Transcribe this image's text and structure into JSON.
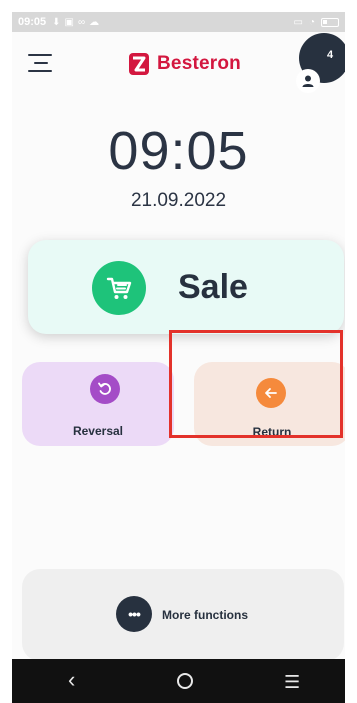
{
  "status_bar": {
    "time": "09:05",
    "icons": [
      "download-icon",
      "image-icon",
      "link-icon",
      "cloud-icon"
    ],
    "right_icons": [
      "cast-icon",
      "wifi-icon",
      "battery-icon"
    ]
  },
  "header": {
    "brand": "Besteron",
    "brand_color": "#d3173f",
    "user_count": "4"
  },
  "clock": {
    "time": "09:05",
    "date": "21.09.2022"
  },
  "actions": {
    "sale": {
      "label": "Sale",
      "icon": "cart-icon",
      "color": "#1ec37a"
    },
    "reversal": {
      "label": "Reversal",
      "icon": "undo-icon",
      "color": "#a44cc7"
    },
    "return": {
      "label": "Return",
      "icon": "arrow-left-icon",
      "color": "#f58a3c"
    },
    "more": {
      "label": "More functions",
      "icon": "more-dots-icon",
      "glyph": "•••"
    }
  },
  "nav": {
    "back": "‹",
    "menu": "☰"
  }
}
